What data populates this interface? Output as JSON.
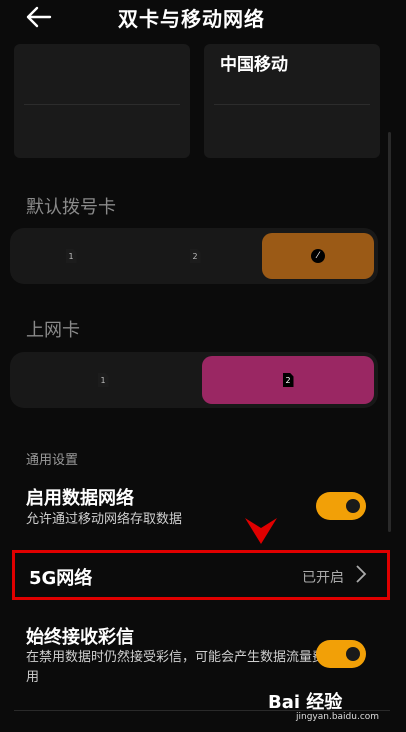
{
  "header": {
    "title": "双卡与移动网络",
    "back_icon": "back-arrow-icon"
  },
  "sims": {
    "sim2_name": "中国移动"
  },
  "default_dial": {
    "label": "默认拨号卡",
    "options": [
      "1",
      "2",
      "⁄"
    ],
    "selected_color": "#9b5a16"
  },
  "data_sim": {
    "label": "上网卡",
    "options": [
      "1",
      "2"
    ],
    "selected_color": "#9a2763"
  },
  "general": {
    "label": "通用设置",
    "mobile_data": {
      "title": "启用数据网络",
      "subtitle": "允许通过移动网络存取数据",
      "enabled": true
    },
    "network_5g": {
      "title": "5G网络",
      "status": "已开启"
    },
    "mms": {
      "title": "始终接收彩信",
      "subtitle": "在禁用数据时仍然接受彩信，可能会产生数据流量费用",
      "enabled": true
    }
  },
  "accent_color": "#f2a007",
  "highlight_color": "#e00000",
  "watermark": {
    "main": "Bai 经验",
    "url": "jingyan.baidu.com"
  }
}
